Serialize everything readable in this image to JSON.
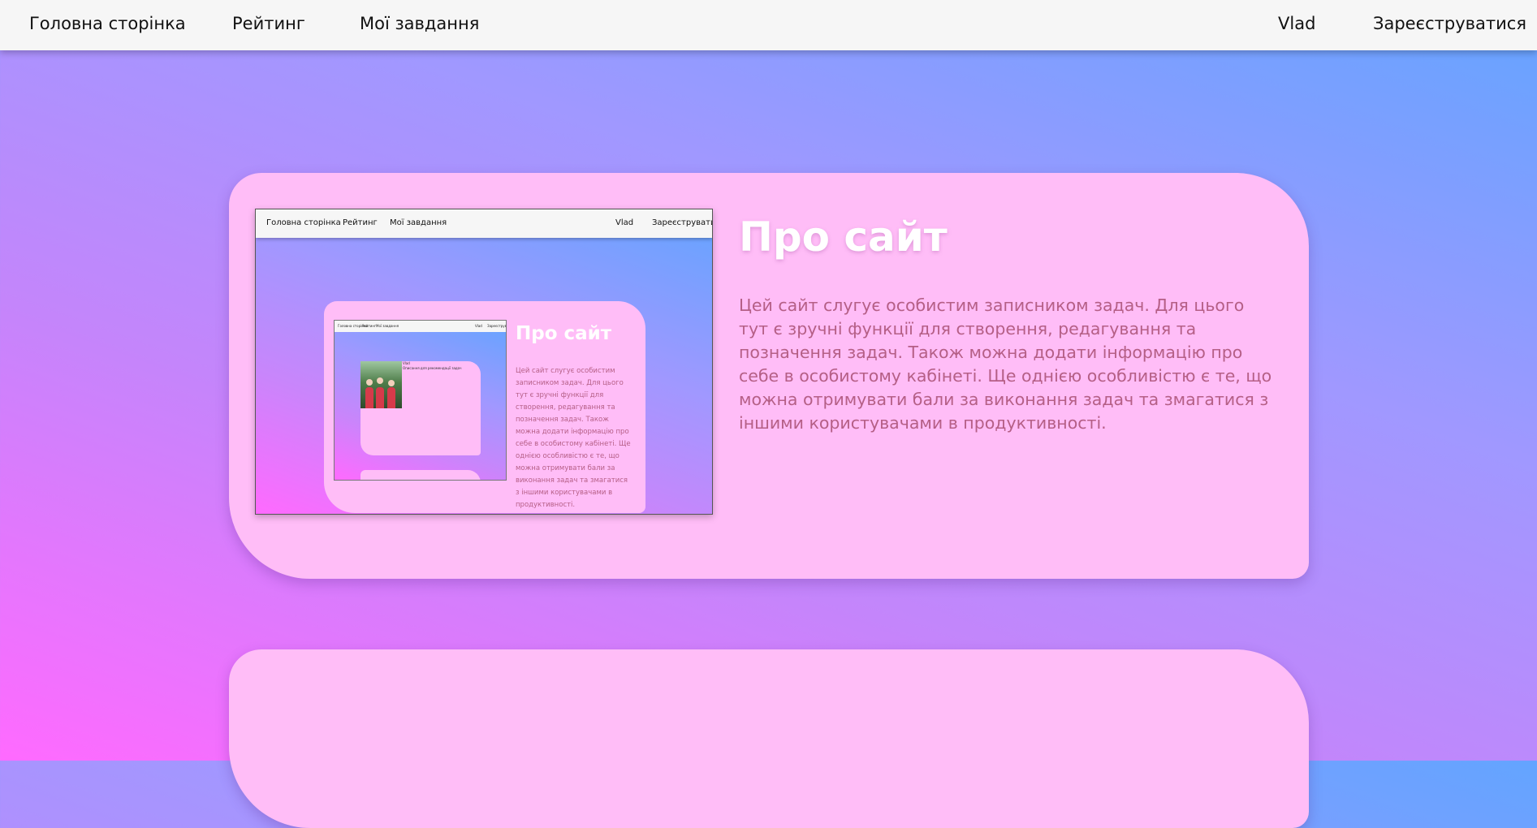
{
  "nav": {
    "home": "Головна сторінка",
    "rating": "Рейтинг",
    "tasks": "Мої завдання",
    "user": "Vlad",
    "register": "Зареєструватися"
  },
  "about": {
    "title": "Про сайт",
    "text": "Цей сайт слугує особистим записником задач. Для цього тут є зручні функції для створення, редагування та позначення задач. Також можна додати інформацію про себе в особистому кабінеті. Ще однією особливістю є те, що можна отримувати бали за виконання задач та змагатися з іншими користувачами в продуктивності."
  },
  "colors": {
    "card": "#ffbdf7",
    "text": "#b55f86",
    "nav_bg": "#f6f6f6"
  },
  "preview": {
    "nested_photo_caption": "Vlad\nОписання для рекомендації задач"
  }
}
